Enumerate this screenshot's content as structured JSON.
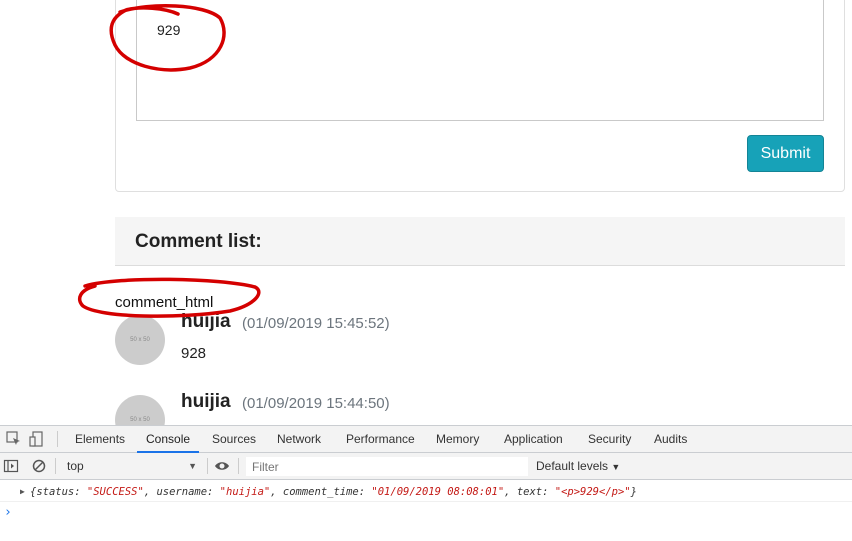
{
  "editor": {
    "text": "929"
  },
  "submit_label": "Submit",
  "comment_list": {
    "title": "Comment list:",
    "debug_text": "comment_html",
    "items": [
      {
        "avatar_text": "50 x 50",
        "username": "huijia",
        "time": "(01/09/2019 15:45:52)",
        "text": "928"
      },
      {
        "avatar_text": "50 x 50",
        "username": "huijia",
        "time": "(01/09/2019 15:44:50)",
        "text": ""
      }
    ]
  },
  "devtools": {
    "tabs": [
      "Elements",
      "Console",
      "Sources",
      "Network",
      "Performance",
      "Memory",
      "Application",
      "Security",
      "Audits"
    ],
    "active_tab": "Console",
    "context": "top",
    "filter_placeholder": "Filter",
    "levels": "Default levels",
    "log": {
      "open": "{",
      "k1": "status: ",
      "v1": "\"SUCCESS\"",
      "k2": ", username: ",
      "v2": "\"huijia\"",
      "k3": ", comment_time: ",
      "v3": "\"01/09/2019 08:08:01\"",
      "k4": ", text: ",
      "v4": "\"<p>929</p>\"",
      "close": "}"
    },
    "prompt": "›"
  },
  "colors": {
    "accent": "#17a2b8",
    "annotation": "#d40000",
    "string": "#c41a16",
    "devtools_blue": "#1a73e8"
  }
}
